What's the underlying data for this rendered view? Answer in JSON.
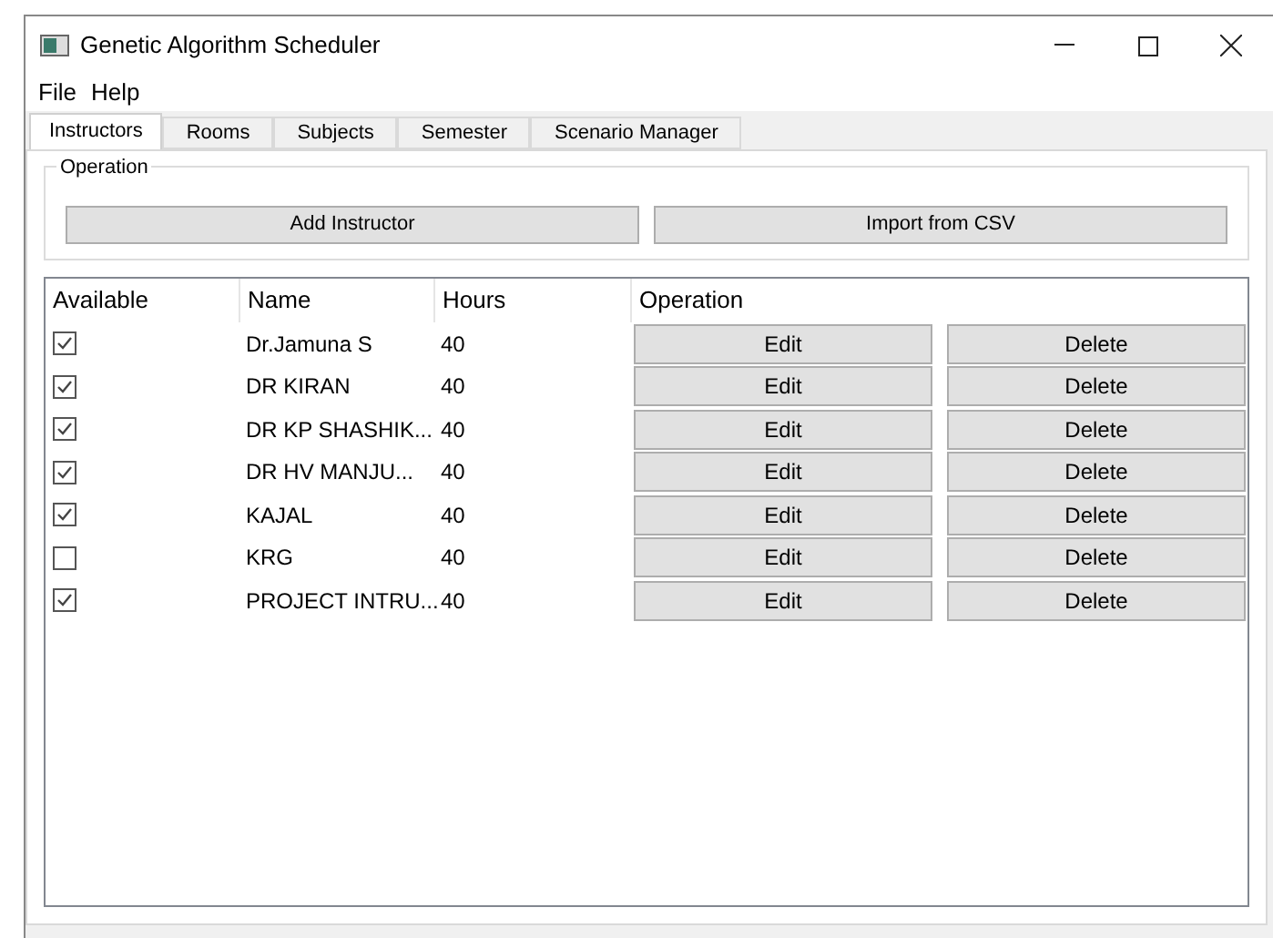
{
  "window": {
    "title": "Genetic Algorithm Scheduler"
  },
  "menu": [
    "File",
    "Help"
  ],
  "tabs": [
    {
      "label": "Instructors",
      "selected": true
    },
    {
      "label": "Rooms",
      "selected": false
    },
    {
      "label": "Subjects",
      "selected": false
    },
    {
      "label": "Semester",
      "selected": false
    },
    {
      "label": "Scenario Manager",
      "selected": false
    }
  ],
  "operation_group": {
    "title": "Operation",
    "buttons": [
      "Add Instructor",
      "Import from CSV"
    ]
  },
  "table": {
    "columns": [
      "Available",
      "Name",
      "Hours",
      "Operation"
    ],
    "rows": [
      {
        "available": true,
        "name": "Dr.Jamuna S",
        "hours": "40",
        "edit": "Edit",
        "delete": "Delete"
      },
      {
        "available": true,
        "name": "DR KIRAN",
        "hours": "40",
        "edit": "Edit",
        "delete": "Delete"
      },
      {
        "available": true,
        "name": "DR KP SHASHIK...",
        "hours": "40",
        "edit": "Edit",
        "delete": "Delete"
      },
      {
        "available": true,
        "name": "DR HV MANJU...",
        "hours": "40",
        "edit": "Edit",
        "delete": "Delete"
      },
      {
        "available": true,
        "name": "KAJAL",
        "hours": "40",
        "edit": "Edit",
        "delete": "Delete"
      },
      {
        "available": false,
        "name": "KRG",
        "hours": "40",
        "edit": "Edit",
        "delete": "Delete"
      },
      {
        "available": true,
        "name": "PROJECT INTRU...",
        "hours": "40",
        "edit": "Edit",
        "delete": "Delete"
      }
    ]
  }
}
